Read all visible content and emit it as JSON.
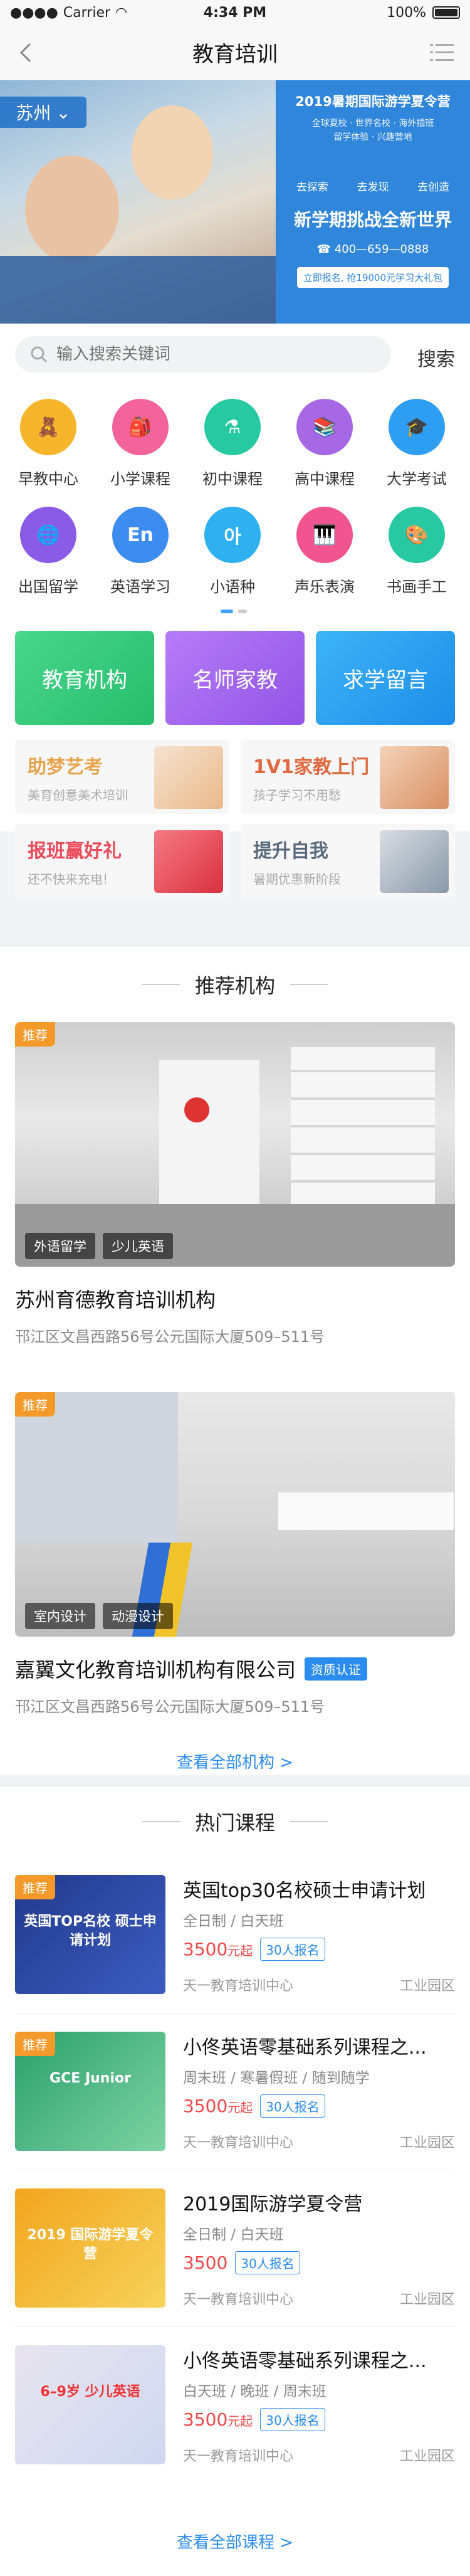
{
  "status": {
    "carrier": "Carrier",
    "time": "4:34 PM",
    "battery": "100%"
  },
  "nav": {
    "title": "教育培训"
  },
  "banner": {
    "city": "苏州",
    "title": "2019暑期国际游学夏令营",
    "sub1": "全球夏校 · 世界名校 · 海外插班",
    "sub2": "留学体验 · 兴趣营地",
    "tags": [
      "去探索",
      "去发现",
      "去创造"
    ],
    "headline": "新学期挑战全新世界",
    "phone": "400—659—0888",
    "cta": "立即报名, 抢19000元学习大礼包"
  },
  "search": {
    "placeholder": "输入搜索关键词",
    "button": "搜索"
  },
  "categories": [
    {
      "label": "早教中心",
      "icon": "abc-blocks-icon",
      "color": "#f7b52c",
      "glyph": "🧸"
    },
    {
      "label": "小学课程",
      "icon": "schoolbag-icon",
      "color": "#f2629b",
      "glyph": "🎒"
    },
    {
      "label": "初中课程",
      "icon": "flask-icon",
      "color": "#27c9a3",
      "glyph": "⚗"
    },
    {
      "label": "高中课程",
      "icon": "books-icon",
      "color": "#a768e6",
      "glyph": "📚"
    },
    {
      "label": "大学考试",
      "icon": "graduation-cap-icon",
      "color": "#2e9ef3",
      "glyph": "🎓"
    },
    {
      "label": "出国留学",
      "icon": "globe-icon",
      "color": "#8a5be6",
      "glyph": "🌐"
    },
    {
      "label": "英语学习",
      "icon": "en-icon",
      "color": "#3d8cf0",
      "glyph": "En"
    },
    {
      "label": "小语种",
      "icon": "korean-icon",
      "color": "#2fb0f0",
      "glyph": "아"
    },
    {
      "label": "声乐表演",
      "icon": "piano-icon",
      "color": "#f0558f",
      "glyph": "🎹"
    },
    {
      "label": "书画手工",
      "icon": "palette-icon",
      "color": "#28c8a3",
      "glyph": "🎨"
    }
  ],
  "tiles": [
    {
      "label": "教育机构",
      "color": "#3ecf84"
    },
    {
      "label": "名师家教",
      "color": "#a970f2"
    },
    {
      "label": "求学留言",
      "color": "#2ea6f5"
    }
  ],
  "promos": [
    {
      "title": "助梦艺考",
      "sub": "美育创意美术培训",
      "color": "#e7a24a"
    },
    {
      "title": "1V1家教上门",
      "sub": "孩子学习不用愁",
      "color": "#e0683f"
    },
    {
      "title": "报班赢好礼",
      "sub": "还不快来充电!",
      "color": "#ea4a5a"
    },
    {
      "title": "提升自我",
      "sub": "暑期优惠新阶段",
      "color": "#5a6a7d"
    }
  ],
  "sections": {
    "institutions": "推荐机构",
    "courses": "热门课程"
  },
  "institutions": [
    {
      "badge": "推荐",
      "tags": [
        "外语留学",
        "少儿英语"
      ],
      "name": "苏州育德教育培训机构",
      "cert": "",
      "address": "邗江区文昌西路56号公元国际大厦509–511号"
    },
    {
      "badge": "推荐",
      "tags": [
        "室内设计",
        "动漫设计"
      ],
      "name": "嘉翼文化教育培训机构有限公司",
      "cert": "资质认证",
      "address": "邗江区文昌西路56号公元国际大厦509–511号"
    }
  ],
  "view_all_institutions": "查看全部机构 >",
  "courses": [
    {
      "badge": "推荐",
      "img_text": "英国TOP名校 硕士申请计划",
      "title": "英国top30名校硕士申请计划",
      "schedule": "全日制 / 白天班",
      "price": "3500",
      "price_unit": "元起",
      "enrolled": "30人报名",
      "school": "天一教育培训中心",
      "area": "工业园区"
    },
    {
      "badge": "推荐",
      "img_text": "GCE Junior",
      "title": "小佟英语零基础系列课程之...",
      "schedule": "周末班 / 寒暑假班 / 随到随学",
      "price": "3500",
      "price_unit": "元起",
      "enrolled": "30人报名",
      "school": "天一教育培训中心",
      "area": "工业园区"
    },
    {
      "badge": "",
      "img_text": "2019 国际游学夏令营",
      "title": "2019国际游学夏令营",
      "schedule": "全日制 / 白天班",
      "price": "3500",
      "price_unit": "",
      "enrolled": "30人报名",
      "school": "天一教育培训中心",
      "area": "工业园区"
    },
    {
      "badge": "",
      "img_text": "6–9岁 少儿英语",
      "title": "小佟英语零基础系列课程之...",
      "schedule": "白天班 / 晚班 / 周末班",
      "price": "3500",
      "price_unit": "元起",
      "enrolled": "30人报名",
      "school": "天一教育培训中心",
      "area": "工业园区"
    }
  ],
  "view_all_courses": "查看全部课程 >"
}
